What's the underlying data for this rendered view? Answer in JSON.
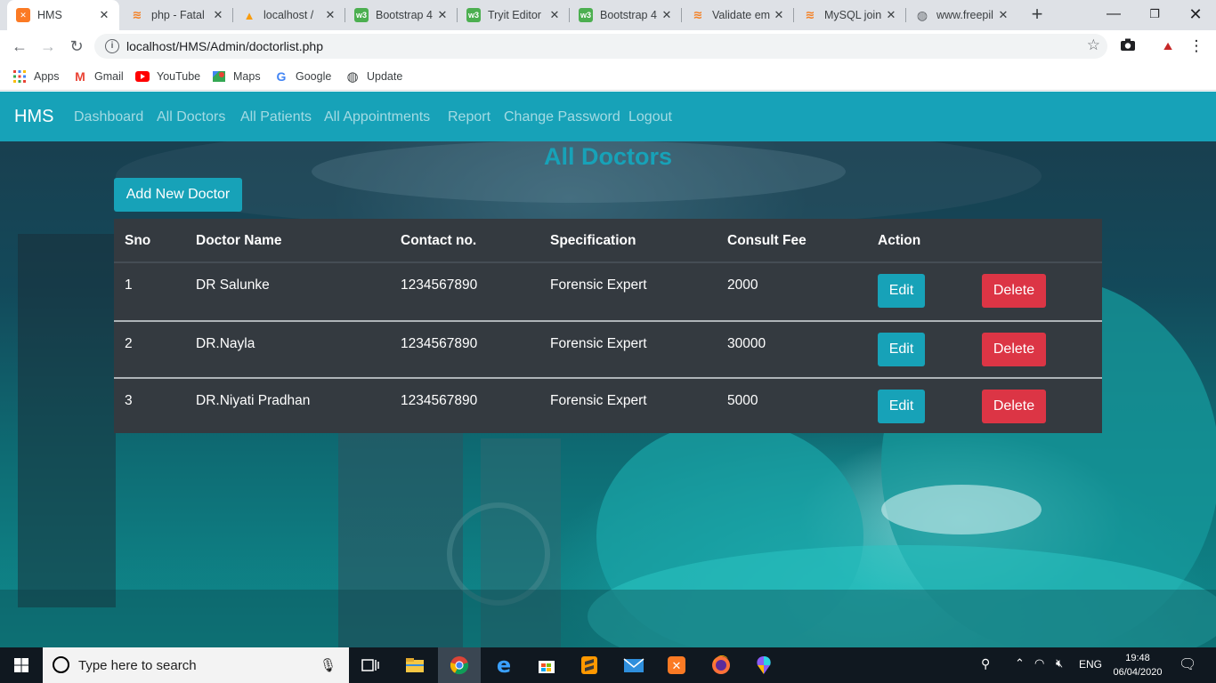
{
  "browser": {
    "tabs": [
      {
        "title": "HMS",
        "active": true,
        "favicon": "xampp-icon",
        "color": "#fb7a24"
      },
      {
        "title": "php - Fatal",
        "active": false,
        "favicon": "stackoverflow-icon",
        "color": "#f48024"
      },
      {
        "title": "localhost /",
        "active": false,
        "favicon": "phpmyadmin-icon",
        "color": "#f89c0e"
      },
      {
        "title": "Bootstrap 4",
        "active": false,
        "favicon": "w3schools-icon",
        "color": "#4caf50"
      },
      {
        "title": "Tryit Editor",
        "active": false,
        "favicon": "w3schools-icon",
        "color": "#4caf50"
      },
      {
        "title": "Bootstrap 4",
        "active": false,
        "favicon": "w3schools-icon",
        "color": "#4caf50"
      },
      {
        "title": "Validate em",
        "active": false,
        "favicon": "stackoverflow-icon",
        "color": "#f48024"
      },
      {
        "title": "MySQL join",
        "active": false,
        "favicon": "stackoverflow-icon",
        "color": "#f48024"
      },
      {
        "title": "www.freepil",
        "active": false,
        "favicon": "globe-icon",
        "color": "#5f6368"
      }
    ],
    "url": "localhost/HMS/Admin/doctorlist.php",
    "bookmarks": [
      {
        "label": "Apps",
        "icon": "apps-grid-icon"
      },
      {
        "label": "Gmail",
        "icon": "gmail-icon"
      },
      {
        "label": "YouTube",
        "icon": "youtube-icon"
      },
      {
        "label": "Maps",
        "icon": "maps-icon"
      },
      {
        "label": "Google",
        "icon": "google-icon"
      },
      {
        "label": "Update",
        "icon": "update-icon"
      }
    ]
  },
  "navbar": {
    "brand": "HMS",
    "links": [
      "Dashboard",
      "All Doctors",
      "All Patients",
      "All Appointments",
      "Report",
      "Change Password",
      "Logout"
    ]
  },
  "main": {
    "heading": "All Doctors",
    "add_button": "Add New Doctor",
    "columns": [
      "Sno",
      "Doctor Name",
      "Contact no.",
      "Specification",
      "Consult Fee",
      "Action"
    ],
    "rows": [
      {
        "sno": "1",
        "name": "DR Salunke",
        "contact": "1234567890",
        "spec": "Forensic Expert",
        "fee": "2000"
      },
      {
        "sno": "2",
        "name": "DR.Nayla",
        "contact": "1234567890",
        "spec": "Forensic Expert",
        "fee": "30000"
      },
      {
        "sno": "3",
        "name": "DR.Niyati Pradhan",
        "contact": "1234567890",
        "spec": "Forensic Expert",
        "fee": "5000"
      }
    ],
    "edit_label": "Edit",
    "delete_label": "Delete"
  },
  "taskbar": {
    "search_placeholder": "Type here to search",
    "language": "ENG",
    "time": "19:48",
    "date": "06/04/2020"
  },
  "colors": {
    "primary": "#17a2b8",
    "danger": "#dc3545",
    "table_dark": "#343a40"
  }
}
